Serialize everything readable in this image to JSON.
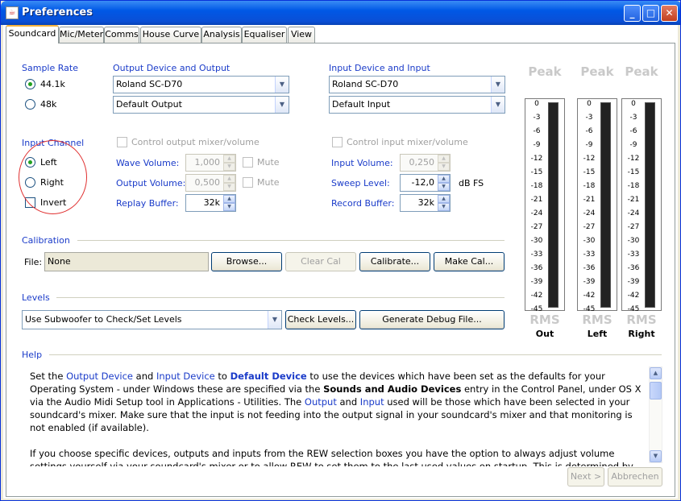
{
  "window": {
    "title": "Preferences",
    "icon": "java-cup-icon"
  },
  "tabs": [
    {
      "label": "Soundcard",
      "active": true
    },
    {
      "label": "Mic/Meter"
    },
    {
      "label": "Comms"
    },
    {
      "label": "House Curve"
    },
    {
      "label": "Analysis"
    },
    {
      "label": "Equaliser"
    },
    {
      "label": "View"
    }
  ],
  "sample_rate": {
    "heading": "Sample Rate",
    "options": [
      "44.1k",
      "48k"
    ],
    "selected": "44.1k"
  },
  "output": {
    "heading": "Output Device and Output",
    "device": "Roland SC-D70",
    "output": "Default Output",
    "mixer_label": "Control output mixer/volume",
    "wave_label": "Wave Volume:",
    "wave_value": "1,000",
    "out_vol_label": "Output Volume:",
    "out_vol_value": "0,500",
    "mute_label": "Mute",
    "replay_label": "Replay Buffer:",
    "replay_value": "32k"
  },
  "input": {
    "heading": "Input Device and Input",
    "device": "Roland SC-D70",
    "input": "Default Input",
    "mixer_label": "Control input mixer/volume",
    "in_vol_label": "Input Volume:",
    "in_vol_value": "0,250",
    "sweep_label": "Sweep Level:",
    "sweep_value": "-12,0",
    "sweep_unit": "dB FS",
    "record_label": "Record Buffer:",
    "record_value": "32k"
  },
  "input_channel": {
    "heading": "Input Channel",
    "options": [
      "Left",
      "Right"
    ],
    "selected": "Left",
    "invert_label": "Invert"
  },
  "calibration": {
    "heading": "Calibration",
    "file_label": "File:",
    "file_value": "None",
    "browse": "Browse...",
    "clear": "Clear Cal",
    "calibrate": "Calibrate...",
    "make": "Make Cal..."
  },
  "levels": {
    "heading": "Levels",
    "mode": "Use Subwoofer to Check/Set Levels",
    "check": "Check Levels...",
    "debug": "Generate Debug File..."
  },
  "meters": {
    "peak_label": "Peak",
    "rms_label": "RMS",
    "scale": [
      "0",
      "-3",
      "-6",
      "-9",
      "-12",
      "-15",
      "-18",
      "-21",
      "-24",
      "-27",
      "-30",
      "-33",
      "-36",
      "-39",
      "-42",
      "-45"
    ],
    "names": [
      "Out",
      "Left",
      "Right"
    ]
  },
  "help": {
    "heading": "Help",
    "p1_a": "Set the ",
    "p1_b": "Output Device",
    "p1_c": " and ",
    "p1_d": "Input Device",
    "p1_e": " to ",
    "p1_f": "Default Device",
    "p1_g": " to use the devices which have been set as the defaults for your Operating System - under Windows these are specified via the ",
    "p1_h": "Sounds and Audio Devices",
    "p1_i": " entry in the Control Panel, under OS X via the Audio Midi Setup tool in Applications - Utilities. The ",
    "p1_j": "Output",
    "p1_k": " and ",
    "p1_l": "Input",
    "p1_m": " used will be those which have been selected in your soundcard's mixer. Make sure that the input is not feeding into the output signal in your soundcard's mixer and that monitoring is not enabled (if available).",
    "p2": "If you choose specific devices, outputs and inputs from the REW selection boxes you have the option to always adjust volume settings yourself via your soundcard's mixer or to allow REW to set them to the last used values on startup. This is determined by the check boxes below the output and input selections. If ticked REW sets the mixer to the volume settings and controls used"
  },
  "footer": {
    "next": "Next >",
    "cancel": "Abbrechen"
  },
  "colors": {
    "accent_blue": "#1a3bc9",
    "annotation_red": "#e03030"
  }
}
